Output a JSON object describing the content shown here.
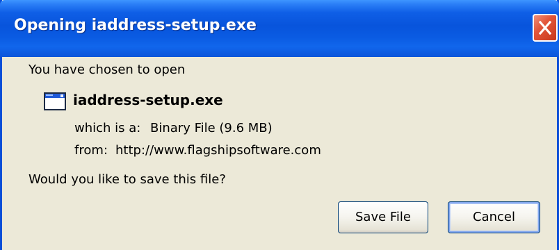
{
  "window": {
    "title": "Opening iaddress-setup.exe",
    "close_icon": "close-icon"
  },
  "dialog": {
    "intro_text": "You have chosen to open",
    "file": {
      "icon": "application-window-icon",
      "name": "iaddress-setup.exe"
    },
    "details": {
      "type_label": "which is a:",
      "type_value": "Binary File (9.6 MB)",
      "from_label": "from:",
      "from_value": "http://www.flagshipsoftware.com"
    },
    "question": "Would you like to save this file?"
  },
  "buttons": {
    "save_label": "Save File",
    "cancel_label": "Cancel"
  },
  "colors": {
    "titlebar": "#0854dc",
    "dialog_background": "#ece9d8",
    "close_button": "#e2563a",
    "button_border": "#003c74"
  }
}
